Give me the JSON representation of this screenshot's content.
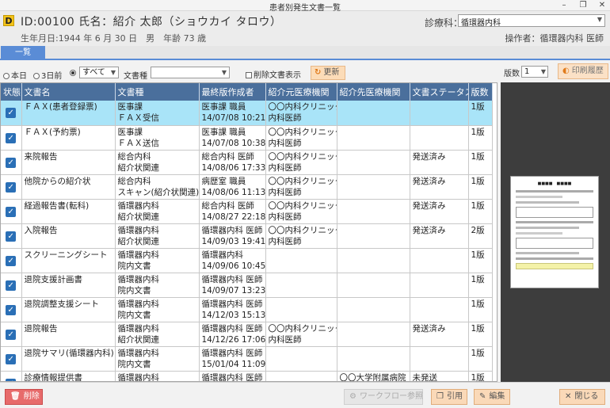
{
  "window": {
    "title": "患者別発生文書一覧"
  },
  "header": {
    "badge": "D",
    "patient": "ID:00100 氏名：紹介 太郎（ショウカイ タロウ）",
    "birth": "生年月日:1944 年 6 月 30 日　男　年齢 73 歳",
    "dept_label": "診療科：",
    "dept_value": "循環器内科",
    "operator": "操作者：循環器内科 医師"
  },
  "tabs": [
    {
      "label": "一覧"
    }
  ],
  "filters": {
    "today": "本日",
    "three_days": "3日前",
    "all": "すべて",
    "range_value": "すべて",
    "doc_type_label": "文書種",
    "doc_type_value": "",
    "show_deleted": "削除文書表示",
    "update": "更新"
  },
  "right_panel": {
    "edition_label": "版数",
    "edition_value": "1",
    "print_history": "印刷履歴"
  },
  "grid": {
    "columns": [
      "状態",
      "文書名",
      "文書種",
      "最終版作成者",
      "紹介元医療機関",
      "紹介先医療機関",
      "文書ステータス",
      "版数"
    ],
    "rows": [
      {
        "name": "ＦＡＸ(患者登録票)",
        "type1": "医事課",
        "type2": "ＦＡＸ受信",
        "author": "医事課 職員",
        "date": "14/07/08 10:21",
        "src1": "〇〇内科クリニック",
        "src2": "内科医師",
        "dest": "",
        "status": "",
        "ver": "1版",
        "selected": true
      },
      {
        "name": "ＦＡＸ(予約票)",
        "type1": "医事課",
        "type2": "ＦＡＸ送信",
        "author": "医事課 職員",
        "date": "14/07/08 10:38",
        "src1": "〇〇内科クリニック",
        "src2": "内科医師",
        "dest": "",
        "status": "",
        "ver": "1版",
        "selected": false
      },
      {
        "name": "来院報告",
        "type1": "総合内科",
        "type2": "紹介状関連",
        "author": "総合内科 医師",
        "date": "14/08/06 17:33",
        "src1": "〇〇内科クリニック",
        "src2": "内科医師",
        "dest": "",
        "status": "発送済み",
        "ver": "1版",
        "selected": false
      },
      {
        "name": "他院からの紹介状",
        "type1": "総合内科",
        "type2": "スキャン(紹介状関連)",
        "author": "病歴室 職員",
        "date": "14/08/06 11:13",
        "src1": "〇〇内科クリニック",
        "src2": "内科医師",
        "dest": "",
        "status": "発送済み",
        "ver": "1版",
        "selected": false
      },
      {
        "name": "経過報告書(転科)",
        "type1": "循環器内科",
        "type2": "紹介状関連",
        "author": "総合内科 医師",
        "date": "14/08/27 22:18",
        "src1": "〇〇内科クリニック",
        "src2": "内科医師",
        "dest": "",
        "status": "発送済み",
        "ver": "1版",
        "selected": false
      },
      {
        "name": "入院報告",
        "type1": "循環器内科",
        "type2": "紹介状関連",
        "author": "循環器内科 医師",
        "date": "14/09/03 19:41",
        "src1": "〇〇内科クリニック",
        "src2": "内科医師",
        "dest": "",
        "status": "発送済み",
        "ver": "2版",
        "selected": false
      },
      {
        "name": "スクリーニングシート",
        "type1": "循環器内科",
        "type2": "院内文書",
        "author": "循環器内科",
        "date": "14/09/06 10:45",
        "src1": "",
        "src2": "",
        "dest": "",
        "status": "",
        "ver": "1版",
        "selected": false
      },
      {
        "name": "退院支援計画書",
        "type1": "循環器内科",
        "type2": "院内文書",
        "author": "循環器内科 医師",
        "date": "14/09/07 13:23",
        "src1": "",
        "src2": "",
        "dest": "",
        "status": "",
        "ver": "1版",
        "selected": false
      },
      {
        "name": "退院調整支援シート",
        "type1": "循環器内科",
        "type2": "院内文書",
        "author": "循環器内科 医師",
        "date": "14/12/03 15:13",
        "src1": "",
        "src2": "",
        "dest": "",
        "status": "",
        "ver": "1版",
        "selected": false
      },
      {
        "name": "退院報告",
        "type1": "循環器内科",
        "type2": "紹介状関連",
        "author": "循環器内科 医師",
        "date": "14/12/26 17:06",
        "src1": "〇〇内科クリニック",
        "src2": "内科医師",
        "dest": "",
        "status": "発送済み",
        "ver": "1版",
        "selected": false
      },
      {
        "name": "退院サマリ(循環器内科)",
        "type1": "循環器内科",
        "type2": "院内文書",
        "author": "循環器内科 医師",
        "date": "15/01/04 11:09",
        "src1": "",
        "src2": "",
        "dest": "",
        "status": "",
        "ver": "1版",
        "selected": false
      },
      {
        "name": "診療情報提供書",
        "type1": "循環器内科",
        "type2": "",
        "author": "循環器内科 医師",
        "date": "",
        "src1": "",
        "src2": "",
        "dest": "〇〇大学附属病院",
        "status": "未発送",
        "ver": "1版",
        "selected": false
      }
    ]
  },
  "bottom": {
    "delete": "削除",
    "workflow": "ワークフロー参照",
    "quote": "引用",
    "edit": "編集",
    "close": "閉じる"
  },
  "colors": {
    "header_blue": "#4a6f9c",
    "selected_row": "#a9e4f8",
    "accent_orange": "#fad9b8",
    "delete_red": "#e76b6b"
  }
}
